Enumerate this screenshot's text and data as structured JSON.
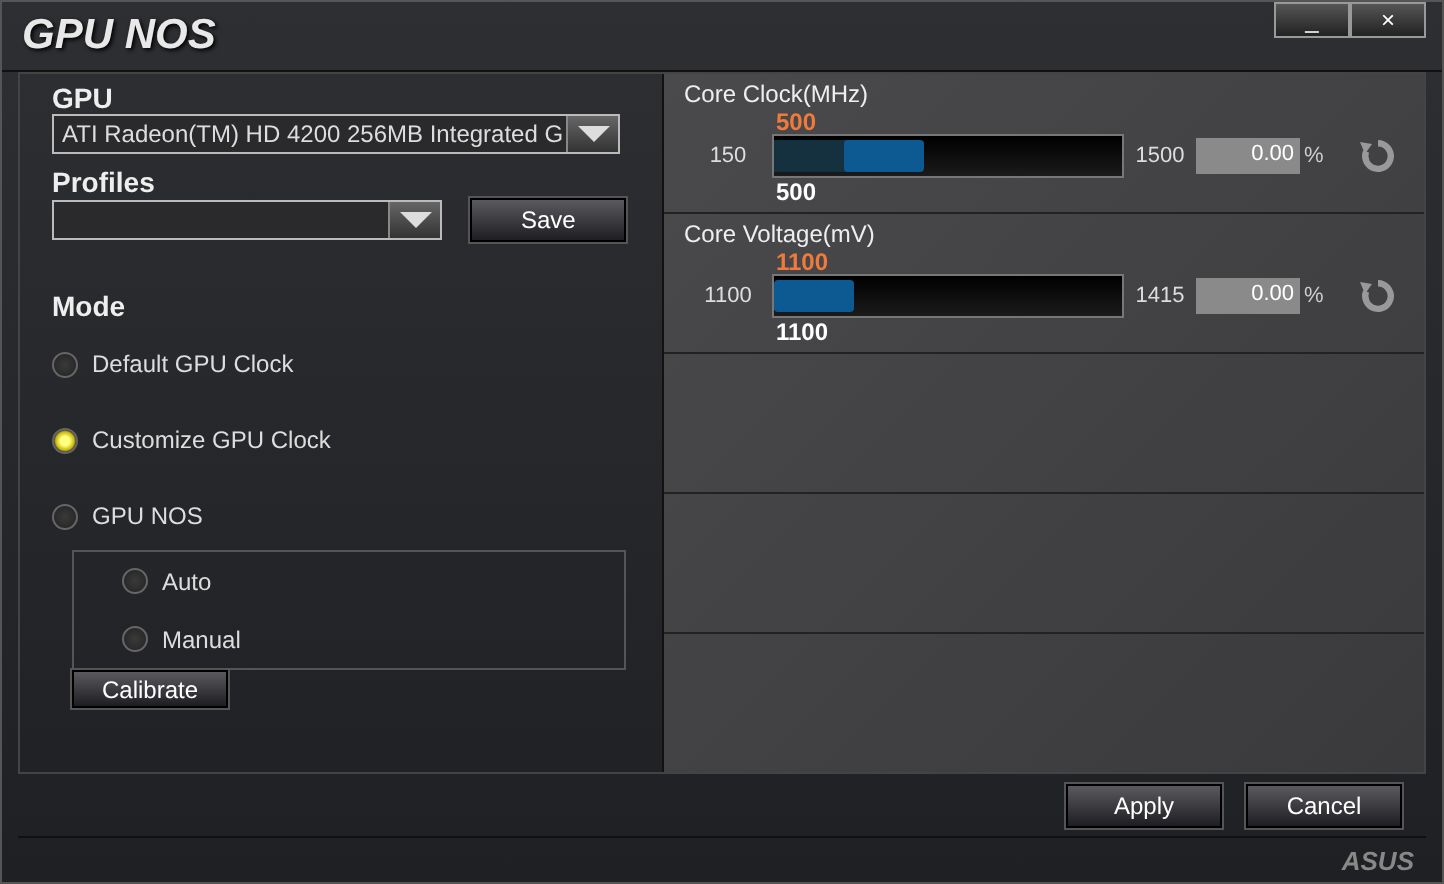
{
  "window": {
    "title": "GPU NOS",
    "controls": [
      "_",
      "×"
    ]
  },
  "gpu": {
    "label": "GPU",
    "value": "ATI Radeon(TM) HD 4200 256MB Integrated G"
  },
  "profiles": {
    "label": "Profiles",
    "save": "Save"
  },
  "mode": {
    "label": "Mode",
    "options": [
      {
        "label": "Default GPU Clock",
        "selected": false
      },
      {
        "label": "Customize GPU Clock",
        "selected": true
      },
      {
        "label": "GPU NOS",
        "selected": false
      }
    ],
    "sub_options": [
      {
        "label": "Auto",
        "selected": false
      },
      {
        "label": "Manual",
        "selected": false
      }
    ],
    "calibrate": "Calibrate"
  },
  "sliders": [
    {
      "title": "Core Clock(MHz)",
      "current": "500",
      "min": "150",
      "max": "1500",
      "level": 0.26,
      "value": "500",
      "percent": "0.00",
      "unit": "%"
    },
    {
      "title": "Core Voltage(mV)",
      "current": "1100",
      "min": "1100",
      "max": "1415",
      "level": 0,
      "value": "1100",
      "percent": "0.00",
      "unit": "%"
    }
  ],
  "buttons": [
    "Apply",
    "Cancel"
  ],
  "logo": "ASUS"
}
